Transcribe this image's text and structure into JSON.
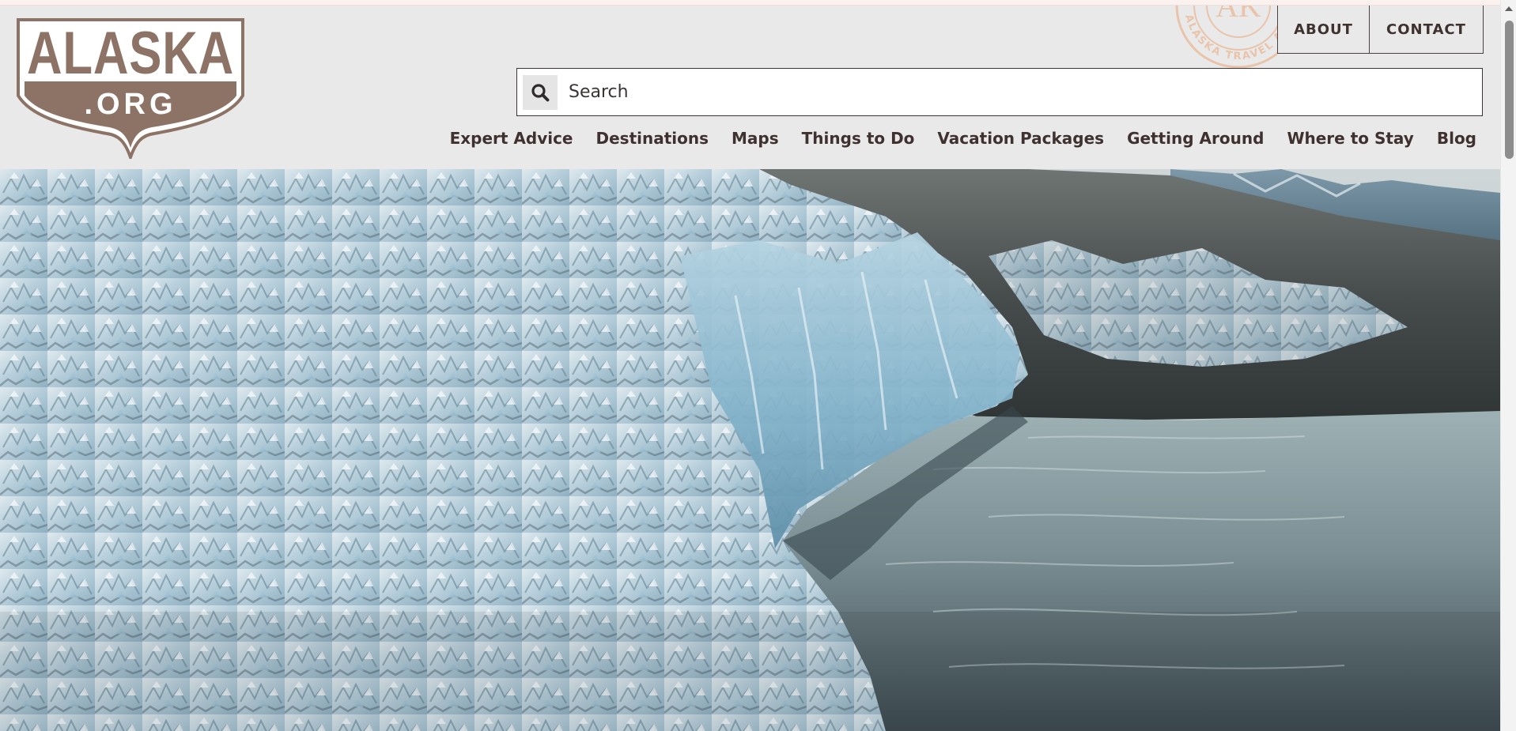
{
  "site": {
    "logo_text": "ALASKA",
    "logo_sub": ".ORG",
    "stamp_text": "ALASKA TRAVEL ADVICE",
    "stamp_initials": "AK"
  },
  "utility_nav": {
    "about": "ABOUT",
    "contact": "CONTACT"
  },
  "search": {
    "placeholder": "Search",
    "value": ""
  },
  "main_nav": {
    "items": [
      {
        "label": "Expert Advice"
      },
      {
        "label": "Destinations"
      },
      {
        "label": "Maps"
      },
      {
        "label": "Things to Do"
      },
      {
        "label": "Vacation Packages"
      },
      {
        "label": "Getting Around"
      },
      {
        "label": "Where to Stay"
      },
      {
        "label": "Blog"
      }
    ]
  },
  "hero": {
    "subject": "tidewater glacier face meeting grey fjord water"
  },
  "colors": {
    "brand_brown": "#8d7365",
    "nav_text": "#3f3130",
    "header_bg": "#e9e9e9",
    "stamp": "#e9a577"
  },
  "icons": [
    "search-icon",
    "scroll-up-arrow-icon"
  ]
}
